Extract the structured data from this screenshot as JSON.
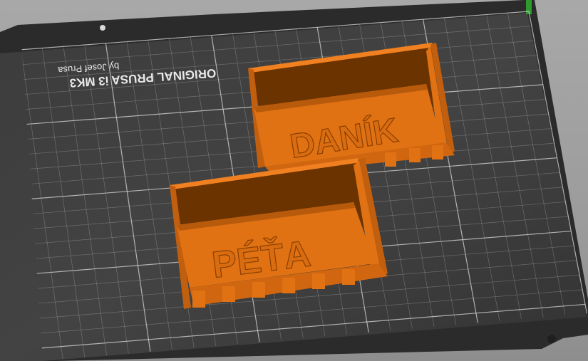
{
  "app": {
    "view": "3D build plate preview"
  },
  "bed": {
    "brand_label": "ORIGINAL PRUSA i3 MK3",
    "author_label": "by Josef Prusa"
  },
  "models": [
    {
      "id": "box-danik",
      "engraved_text": "DANÍK",
      "color": "#e07214"
    },
    {
      "id": "box-peta",
      "engraved_text": "PÉŤA",
      "color": "#e07214"
    }
  ],
  "colors": {
    "bed_surface": "#3a3a3a",
    "bed_frame": "#2b2b2b",
    "grid_line": "#d8d8d8",
    "model_orange": "#e07214",
    "model_dark": "#6b3300",
    "background": "#9c9c9c"
  }
}
